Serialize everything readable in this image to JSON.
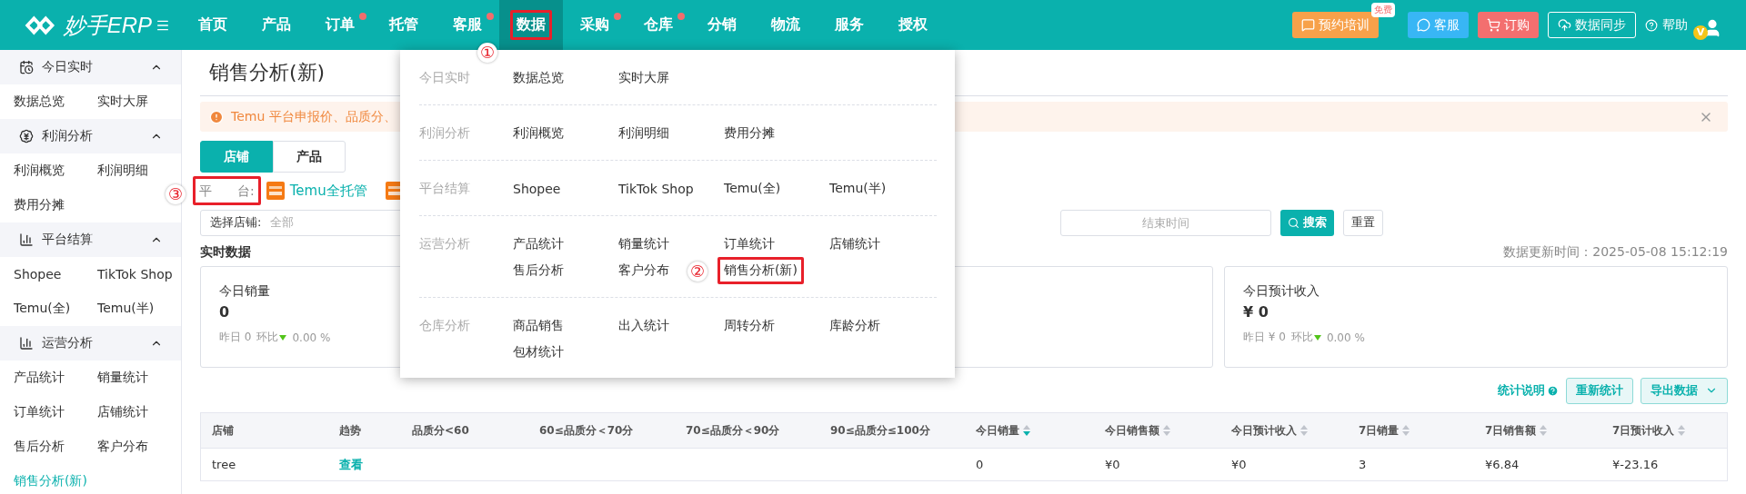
{
  "app": {
    "logo": "妙手ERP"
  },
  "nav": [
    {
      "label": "首页",
      "badge": false,
      "selected": false,
      "highlighted": false
    },
    {
      "label": "产品",
      "badge": false,
      "selected": false,
      "highlighted": false
    },
    {
      "label": "订单",
      "badge": true,
      "selected": false,
      "highlighted": false
    },
    {
      "label": "托管",
      "badge": false,
      "selected": false,
      "highlighted": false
    },
    {
      "label": "客服",
      "badge": true,
      "selected": false,
      "highlighted": false
    },
    {
      "label": "数据",
      "badge": false,
      "selected": true,
      "highlighted": true,
      "marker": "①"
    },
    {
      "label": "采购",
      "badge": true,
      "selected": false,
      "highlighted": false
    },
    {
      "label": "仓库",
      "badge": true,
      "selected": false,
      "highlighted": false
    },
    {
      "label": "分销",
      "badge": false,
      "selected": false,
      "highlighted": false
    },
    {
      "label": "物流",
      "badge": false,
      "selected": false,
      "highlighted": false
    },
    {
      "label": "服务",
      "badge": false,
      "selected": false,
      "highlighted": false
    },
    {
      "label": "授权",
      "badge": false,
      "selected": false,
      "highlighted": false
    }
  ],
  "header_actions": {
    "training": "预约培训",
    "training_badge": "免费",
    "service": "客服",
    "order": "订购",
    "sync": "数据同步",
    "help": "帮助",
    "avatar_badge": "V"
  },
  "sidebar": {
    "groups": [
      {
        "title": "今日实时",
        "expanded": true,
        "items": [
          {
            "label": "数据总览",
            "selected": false
          },
          {
            "label": "实时大屏",
            "selected": false
          }
        ]
      },
      {
        "title": "利润分析",
        "expanded": true,
        "items": [
          {
            "label": "利润概览",
            "selected": false
          },
          {
            "label": "利润明细",
            "selected": false
          },
          {
            "label": "费用分摊",
            "selected": false
          }
        ]
      },
      {
        "title": "平台结算",
        "expanded": true,
        "items": [
          {
            "label": "Shopee",
            "selected": false
          },
          {
            "label": "TikTok Shop",
            "selected": false
          },
          {
            "label": "Temu(全)",
            "selected": false
          },
          {
            "label": "Temu(半)",
            "selected": false
          }
        ]
      },
      {
        "title": "运营分析",
        "expanded": true,
        "items": [
          {
            "label": "产品统计",
            "selected": false
          },
          {
            "label": "销量统计",
            "selected": false
          },
          {
            "label": "订单统计",
            "selected": false
          },
          {
            "label": "店铺统计",
            "selected": false
          },
          {
            "label": "售后分析",
            "selected": false
          },
          {
            "label": "客户分布",
            "selected": false
          },
          {
            "label": "销售分析(新)",
            "selected": true
          }
        ]
      }
    ]
  },
  "page": {
    "title": "销售分析(新)",
    "alert": "Temu 平台申报价、品质分、",
    "tabs": [
      {
        "label": "店铺",
        "selected": true
      },
      {
        "label": "产品",
        "selected": false
      }
    ],
    "platform": {
      "label": "平　　台:",
      "highlighted": true,
      "marker": "③",
      "option": "Temu全托管"
    },
    "filter": {
      "store_label": "选择店铺:",
      "store_value": "全部",
      "end_placeholder": "结束时间",
      "search": "搜索",
      "reset": "重置"
    },
    "section_title": "实时数据",
    "update_time": "数据更新时间：2025-05-08 15:12:19",
    "cards": [
      {
        "title": "今日销量",
        "value": "0",
        "yesterday": "昨日 0",
        "ratio_label": "环比",
        "change": "0.00 %"
      },
      {
        "title": "今日预计收入",
        "value": "¥ 0",
        "yesterday": "昨日 ¥ 0",
        "ratio_label": "环比",
        "change": "0.00 %"
      }
    ]
  },
  "table": {
    "help": "统计说明",
    "recount": "重新统计",
    "export": "导出数据",
    "columns": [
      {
        "label": "店铺",
        "sortable": false
      },
      {
        "label": "趋势",
        "sortable": false
      },
      {
        "label": "品质分<60",
        "sortable": false
      },
      {
        "label": "60≤品质分＜70分",
        "sortable": false
      },
      {
        "label": "70≤品质分＜90分",
        "sortable": false
      },
      {
        "label": "90≤品质分≤100分",
        "sortable": false
      },
      {
        "label": "今日销量",
        "sortable": true,
        "sorted": true
      },
      {
        "label": "今日销售额",
        "sortable": true,
        "sorted": false
      },
      {
        "label": "今日预计收入",
        "sortable": true,
        "sorted": false
      },
      {
        "label": "7日销量",
        "sortable": true,
        "sorted": false
      },
      {
        "label": "7日销售额",
        "sortable": true,
        "sorted": false
      },
      {
        "label": "7日预计收入",
        "sortable": true,
        "sorted": false
      }
    ],
    "rows": [
      [
        {
          "text": "tree",
          "kind": "text"
        },
        {
          "text": "查看",
          "kind": "link"
        },
        {
          "text": "",
          "kind": "text"
        },
        {
          "text": "",
          "kind": "text"
        },
        {
          "text": "",
          "kind": "text"
        },
        {
          "text": "",
          "kind": "text"
        },
        {
          "text": "0",
          "kind": "text"
        },
        {
          "text": "¥0",
          "kind": "text"
        },
        {
          "text": "¥0",
          "kind": "text"
        },
        {
          "text": "3",
          "kind": "text"
        },
        {
          "text": "¥6.84",
          "kind": "text"
        },
        {
          "text": "¥-23.16",
          "kind": "text"
        }
      ]
    ]
  },
  "menu": {
    "groups": [
      {
        "label": "今日实时",
        "items": [
          {
            "label": "数据总览",
            "highlighted": false
          },
          {
            "label": "实时大屏",
            "highlighted": false
          }
        ]
      },
      {
        "label": "利润分析",
        "items": [
          {
            "label": "利润概览",
            "highlighted": false
          },
          {
            "label": "利润明细",
            "highlighted": false
          },
          {
            "label": "费用分摊",
            "highlighted": false
          }
        ]
      },
      {
        "label": "平台结算",
        "items": [
          {
            "label": "Shopee",
            "highlighted": false
          },
          {
            "label": "TikTok Shop",
            "highlighted": false
          },
          {
            "label": "Temu(全)",
            "highlighted": false
          },
          {
            "label": "Temu(半)",
            "highlighted": false
          }
        ]
      },
      {
        "label": "运营分析",
        "items": [
          {
            "label": "产品统计",
            "highlighted": false
          },
          {
            "label": "销量统计",
            "highlighted": false
          },
          {
            "label": "订单统计",
            "highlighted": false
          },
          {
            "label": "店铺统计",
            "highlighted": false
          },
          {
            "label": "售后分析",
            "highlighted": false
          },
          {
            "label": "客户分布",
            "highlighted": false
          },
          {
            "label": "销售分析(新)",
            "highlighted": true,
            "marker": "②"
          }
        ]
      },
      {
        "label": "仓库分析",
        "items": [
          {
            "label": "商品销售",
            "highlighted": false
          },
          {
            "label": "出入统计",
            "highlighted": false
          },
          {
            "label": "周转分析",
            "highlighted": false
          },
          {
            "label": "库龄分析",
            "highlighted": false
          },
          {
            "label": "包材统计",
            "highlighted": false
          }
        ]
      }
    ]
  }
}
